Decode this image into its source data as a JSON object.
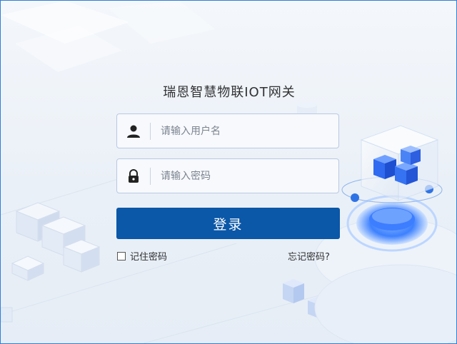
{
  "title": "瑞恩智慧物联IOT网关",
  "username": {
    "placeholder": "请输入用户名",
    "value": ""
  },
  "password": {
    "placeholder": "请输入密码",
    "value": ""
  },
  "login_label": "登录",
  "remember_label": "记住密码",
  "forgot_label": "忘记密码?",
  "colors": {
    "primary": "#0b57a8",
    "accent": "#2f7fd9",
    "field_border": "#b9c9e4"
  }
}
